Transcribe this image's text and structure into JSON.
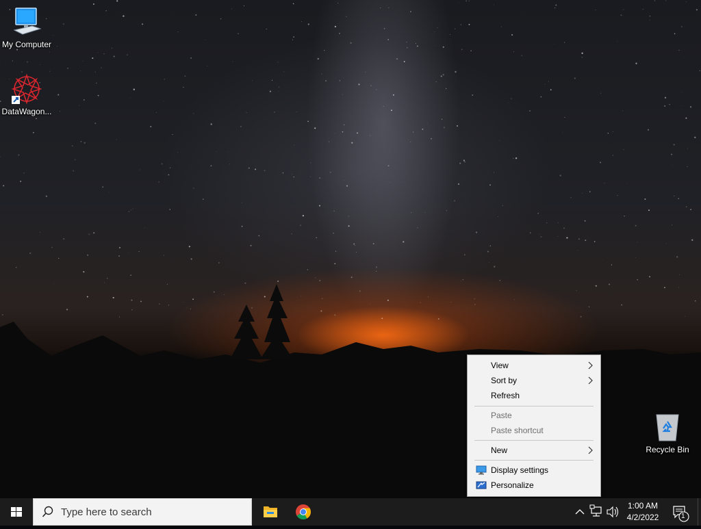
{
  "desktop": {
    "icons": [
      {
        "label": "My Computer",
        "icon": "computer-icon"
      },
      {
        "label": "DataWagon...",
        "icon": "datawagon-icon"
      },
      {
        "label": "Recycle Bin",
        "icon": "recycle-bin-icon"
      }
    ]
  },
  "context_menu": {
    "items": [
      {
        "label": "View",
        "submenu": true,
        "enabled": true
      },
      {
        "label": "Sort by",
        "submenu": true,
        "enabled": true
      },
      {
        "label": "Refresh",
        "submenu": false,
        "enabled": true
      },
      {
        "label": "Paste",
        "submenu": false,
        "enabled": false
      },
      {
        "label": "Paste shortcut",
        "submenu": false,
        "enabled": false
      },
      {
        "label": "New",
        "submenu": true,
        "enabled": true
      },
      {
        "label": "Display settings",
        "submenu": false,
        "enabled": true,
        "icon": "display-settings-icon"
      },
      {
        "label": "Personalize",
        "submenu": false,
        "enabled": true,
        "icon": "personalize-icon"
      }
    ]
  },
  "taskbar": {
    "search_placeholder": "Type here to search",
    "pinned": [
      {
        "name": "File Explorer",
        "icon": "file-explorer-icon"
      },
      {
        "name": "Google Chrome",
        "icon": "chrome-icon"
      }
    ],
    "tray": {
      "time": "1:00 AM",
      "date": "4/2/2022",
      "notification_count": "1"
    }
  }
}
